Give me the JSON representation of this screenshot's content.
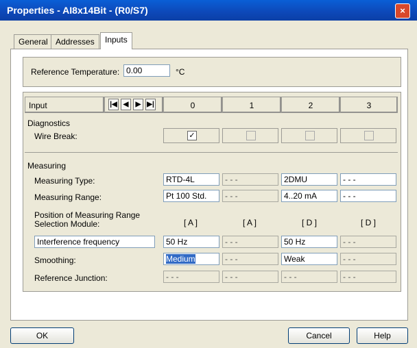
{
  "window": {
    "title": "Properties - AI8x14Bit - (R0/S7)",
    "close_label": "×"
  },
  "tabs": [
    {
      "label": "General",
      "active": false
    },
    {
      "label": "Addresses",
      "active": false
    },
    {
      "label": "Inputs",
      "active": true
    }
  ],
  "reference_temperature": {
    "label": "Reference Temperature:",
    "value": "0.00",
    "unit": "°C"
  },
  "inputs_header": {
    "label": "Input",
    "columns": [
      "0",
      "1",
      "2",
      "3"
    ]
  },
  "diagnostics": {
    "title": "Diagnostics",
    "wire_break_label": "Wire Break:",
    "wire_break": [
      {
        "checked": true,
        "enabled": true
      },
      {
        "checked": false,
        "enabled": false
      },
      {
        "checked": false,
        "enabled": false
      },
      {
        "checked": false,
        "enabled": false
      }
    ]
  },
  "measuring": {
    "title": "Measuring",
    "type_label": "Measuring Type:",
    "type_values": [
      "RTD-4L",
      "- - -",
      "2DMU",
      "- - -"
    ],
    "range_label": "Measuring Range:",
    "range_values": [
      "Pt 100 Std.",
      "- - -",
      "4..20 mA",
      "- - -"
    ],
    "position_label": "Position of Measuring Range Selection Module:",
    "position_values": [
      "[ A ]",
      "[ A ]",
      "[ D ]",
      "[ D ]"
    ],
    "interference_label": "Interference frequency",
    "interference_values": [
      "50 Hz",
      "- - -",
      "50 Hz",
      "- - -"
    ],
    "smoothing_label": "Smoothing:",
    "smoothing_values": [
      "Medium",
      "- - -",
      "Weak",
      "- - -"
    ],
    "refjunction_label": "Reference Junction:",
    "refjunction_values": [
      "- - -",
      "- - -",
      "- - -",
      "- - -"
    ]
  },
  "buttons": {
    "ok": "OK",
    "cancel": "Cancel",
    "help": "Help"
  }
}
